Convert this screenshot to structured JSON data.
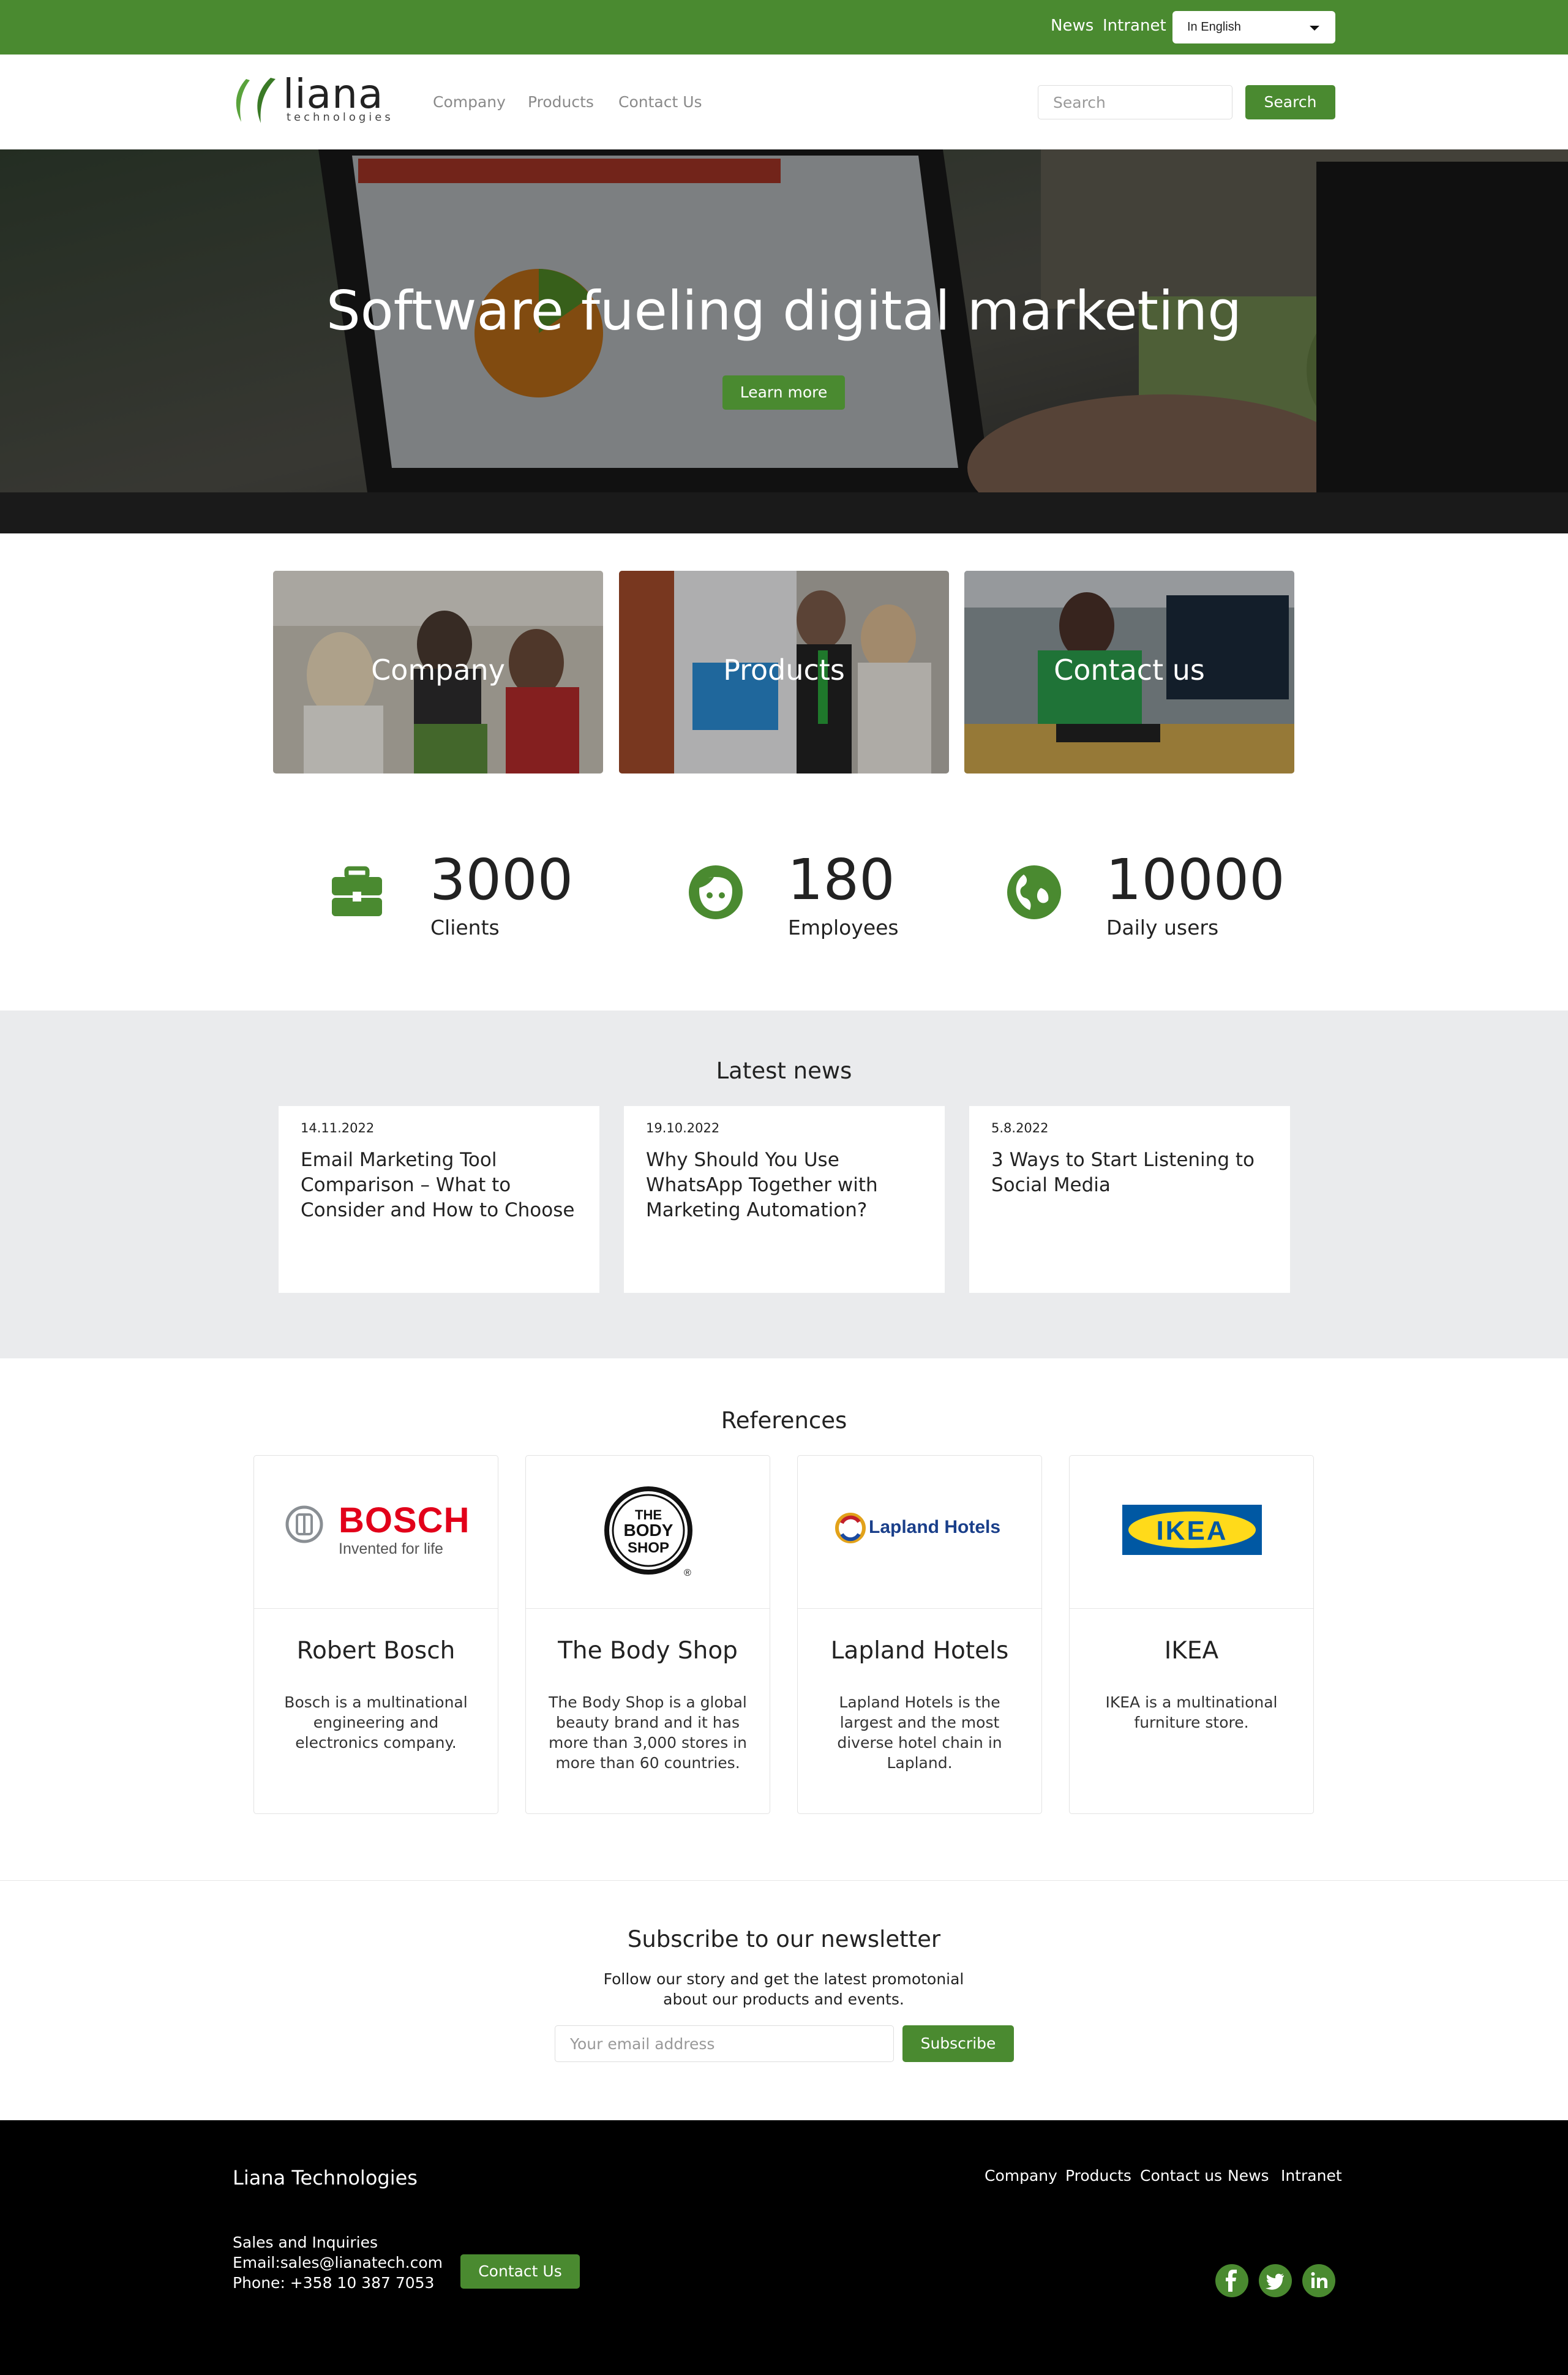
{
  "topbar": {
    "news": "News",
    "intranet": "Intranet",
    "language_selected": "In English"
  },
  "header": {
    "logo_text": "liana",
    "logo_sub": "technologies",
    "nav": [
      "Company",
      "Products",
      "Contact Us"
    ],
    "search_placeholder": "Search",
    "search_button": "Search"
  },
  "hero": {
    "title": "Software fueling digital marketing",
    "button": "Learn more"
  },
  "tiles": [
    "Company",
    "Products",
    "Contact us"
  ],
  "stats": [
    {
      "icon": "briefcase-icon",
      "value": "3000",
      "label": "Clients"
    },
    {
      "icon": "face-icon",
      "value": "180",
      "label": "Employees"
    },
    {
      "icon": "globe-icon",
      "value": "10000",
      "label": "Daily users"
    }
  ],
  "news": {
    "title": "Latest news",
    "items": [
      {
        "date": "14.11.2022",
        "title": "Email Marketing Tool Comparison – What to Consider and How to Choose"
      },
      {
        "date": "19.10.2022",
        "title": "Why Should You Use WhatsApp Together with Marketing Automation?"
      },
      {
        "date": "5.8.2022",
        "title": "3 Ways to Start Listening to Social Media"
      }
    ]
  },
  "references": {
    "title": "References",
    "items": [
      {
        "logo": "bosch-logo",
        "name": "Robert Bosch",
        "desc": "Bosch is a multinational engineering and electronics company.",
        "logo_text": "BOSCH",
        "logo_tagline": "Invented for life"
      },
      {
        "logo": "body-shop-logo",
        "name": "The Body Shop",
        "desc": "The Body Shop is a global beauty brand and it has more than 3,000 stores in more than 60 countries.",
        "logo_text": "THE BODY SHOP"
      },
      {
        "logo": "lapland-hotels-logo",
        "name": "Lapland Hotels",
        "desc": "Lapland Hotels is the largest and the most diverse hotel chain in Lapland.",
        "logo_text": "Lapland Hotels"
      },
      {
        "logo": "ikea-logo",
        "name": "IKEA",
        "desc": "IKEA is a multinational furniture store.",
        "logo_text": "IKEA"
      }
    ]
  },
  "newsletter": {
    "title": "Subscribe to our newsletter",
    "desc": "Follow our story and get the latest promotonial about our products and events.",
    "placeholder": "Your email address",
    "button": "Subscribe"
  },
  "footer": {
    "company": "Liana Technologies",
    "links": [
      "Company",
      "Products",
      "Contact us",
      "News",
      "Intranet"
    ],
    "sales": "Sales and Inquiries",
    "email": "Email:sales@lianatech.com",
    "phone": "Phone: +358 10 387 7053",
    "contact_button": "Contact Us",
    "social": [
      "facebook-icon",
      "twitter-icon",
      "linkedin-icon"
    ]
  },
  "colors": {
    "brand_green": "#4a8a30",
    "footer_bg": "#000000",
    "news_bg": "#eaebed"
  }
}
